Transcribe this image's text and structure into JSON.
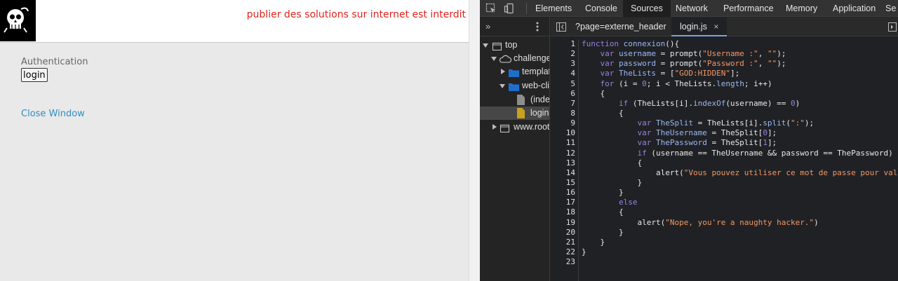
{
  "page": {
    "notice": "publier des solutions sur internet est interdit",
    "auth_label": "Authentication",
    "login_button": "login",
    "close_link": "Close Window"
  },
  "devtools": {
    "tabs": [
      "Elements",
      "Console",
      "Sources",
      "Network",
      "Performance",
      "Memory",
      "Application",
      "Se"
    ],
    "active_tab": "Sources",
    "tree": {
      "top": "top",
      "challenge": "challenge",
      "templates": "templat",
      "web_client": "web-cli",
      "index": "(inde",
      "login": "login",
      "root": "www.root"
    },
    "editor_tabs": {
      "tab1": "?page=externe_header",
      "tab2": "login.js"
    },
    "line_numbers": [
      "1",
      "2",
      "3",
      "4",
      "5",
      "6",
      "7",
      "8",
      "9",
      "10",
      "11",
      "12",
      "13",
      "14",
      "15",
      "16",
      "17",
      "18",
      "19",
      "20",
      "21",
      "22",
      "23"
    ]
  },
  "code": {
    "l1_kw": "function ",
    "l1_fn": "connexion",
    "l1_rest": "(){",
    "l2_kw": "    var ",
    "l2_var": "username",
    "l2_mid": " = prompt(",
    "l2_s1": "\"Username :\"",
    "l2_c": ", ",
    "l2_s2": "\"\"",
    "l2_end": ");",
    "l3_kw": "    var ",
    "l3_var": "password",
    "l3_mid": " = prompt(",
    "l3_s1": "\"Password :\"",
    "l3_c": ", ",
    "l3_s2": "\"\"",
    "l3_end": ");",
    "l4_kw": "    var ",
    "l4_var": "TheLists",
    "l4_mid": " = [",
    "l4_s": "\"GOD:HIDDEN\"",
    "l4_end": "];",
    "l5_kw": "    for ",
    "l5_a": "(i = ",
    "l5_n": "0",
    "l5_b": "; i < TheLists.",
    "l5_p": "length",
    "l5_c": "; i++)",
    "l6": "    {",
    "l7_kw": "        if ",
    "l7_a": "(TheLists[i].",
    "l7_fn": "indexOf",
    "l7_b": "(username) == ",
    "l7_n": "0",
    "l7_c": ")",
    "l8": "        {",
    "l9_kw": "            var ",
    "l9_var": "TheSplit",
    "l9_a": " = TheLists[i].",
    "l9_fn": "split",
    "l9_b": "(",
    "l9_s": "\":\"",
    "l9_c": ");",
    "l10_kw": "            var ",
    "l10_var": "TheUsername",
    "l10_a": " = TheSplit[",
    "l10_n": "0",
    "l10_b": "];",
    "l11_kw": "            var ",
    "l11_var": "ThePassword",
    "l11_a": " = TheSplit[",
    "l11_n": "1",
    "l11_b": "];",
    "l12_kw": "            if ",
    "l12_a": "(username == TheUsername && password == ThePassword)",
    "l13": "            {",
    "l14_a": "                alert(",
    "l14_s": "\"Vous pouvez utiliser ce mot de passe pour vali",
    "l15": "            }",
    "l16": "        }",
    "l17_kw": "        else",
    "l18": "        {",
    "l19_a": "            alert(",
    "l19_s": "\"Nope, you're a naughty hacker.\"",
    "l19_b": ")",
    "l20": "        }",
    "l21": "    }",
    "l22": "}",
    "l23": ""
  },
  "colors": {
    "notice": "#e0231b",
    "link": "#2f8fc2",
    "keyword": "#9a7fe0",
    "string": "#f29766",
    "identifier": "#9ab8f5"
  },
  "icons": [
    "skull-logo-icon",
    "inspect-element-icon",
    "device-toolbar-icon",
    "chevron-double-right-icon",
    "kebab-menu-icon",
    "toggle-navigator-icon",
    "close-icon",
    "folder-icon",
    "file-icon",
    "frame-icon",
    "cloud-icon"
  ]
}
